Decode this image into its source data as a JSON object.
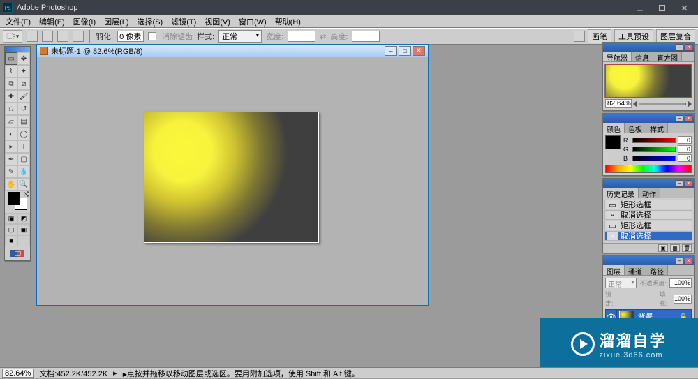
{
  "app": {
    "title": "Adobe Photoshop"
  },
  "menu": [
    "文件(F)",
    "编辑(E)",
    "图像(I)",
    "图层(L)",
    "选择(S)",
    "滤镜(T)",
    "视图(V)",
    "窗口(W)",
    "帮助(H)"
  ],
  "options": {
    "feather_label": "羽化:",
    "feather_value": "0 像素",
    "antialias_label": "消除锯齿",
    "style_label": "样式:",
    "style_value": "正常",
    "width_label": "宽度:",
    "height_label": "高度:",
    "right_tabs": [
      "画笔",
      "工具预设",
      "图层复合"
    ]
  },
  "doc": {
    "title": "未标题-1 @ 82.6%(RGB/8)"
  },
  "navigator": {
    "tabs": [
      "导航器",
      "信息",
      "直方图"
    ],
    "zoom": "82.64%"
  },
  "color": {
    "tabs": [
      "颜色",
      "色板",
      "样式"
    ],
    "r_label": "R",
    "g_label": "G",
    "b_label": "B",
    "r": "0",
    "g": "0",
    "b": "0"
  },
  "history": {
    "tabs": [
      "历史记录",
      "动作"
    ],
    "items": [
      "矩形选框",
      "取消选择",
      "矩形选框",
      "取消选择"
    ],
    "selected": 3
  },
  "layers": {
    "tabs": [
      "图层",
      "通道",
      "路径"
    ],
    "blend": "正常",
    "opacity_label": "不透明度:",
    "opacity": "100%",
    "lock_label": "锁定:",
    "fill_label": "填充:",
    "fill": "100%",
    "layer_name": "背景"
  },
  "status": {
    "zoom": "82.64%",
    "docinfo": "文档:452.2K/452.2K",
    "hint": "点按并拖移以移动图层或选区。要用附加选项，使用 Shift 和 Alt 键。"
  },
  "watermark": {
    "big": "溜溜自学",
    "small": "zixue.3d66.com"
  }
}
